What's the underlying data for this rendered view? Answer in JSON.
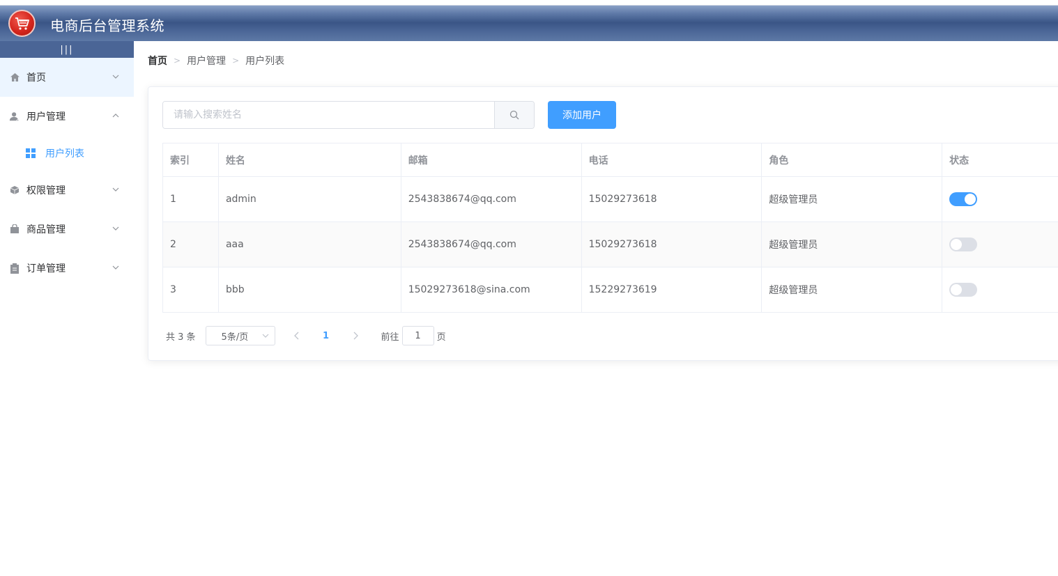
{
  "header": {
    "title": "电商后台管理系统",
    "logo_icon": "shopping-cart-icon"
  },
  "sidebar": {
    "toggle_label": "|||",
    "items": [
      {
        "label": "首页",
        "icon": "home-icon"
      },
      {
        "label": "用户管理",
        "icon": "user-icon",
        "expanded": true
      },
      {
        "label": "权限管理",
        "icon": "box-icon"
      },
      {
        "label": "商品管理",
        "icon": "bag-icon"
      },
      {
        "label": "订单管理",
        "icon": "clipboard-icon"
      }
    ],
    "sub_items": [
      {
        "label": "用户列表",
        "icon": "grid-icon",
        "active": true
      }
    ]
  },
  "breadcrumb": [
    "首页",
    "用户管理",
    "用户列表"
  ],
  "search": {
    "placeholder": "请输入搜索姓名",
    "value": ""
  },
  "add_button_label": "添加用户",
  "table": {
    "headers": [
      "索引",
      "姓名",
      "邮箱",
      "电话",
      "角色",
      "状态"
    ],
    "rows": [
      {
        "index": "1",
        "name": "admin",
        "email": "2543838674@qq.com",
        "phone": "15029273618",
        "role": "超级管理员",
        "status": true
      },
      {
        "index": "2",
        "name": "aaa",
        "email": "2543838674@qq.com",
        "phone": "15029273618",
        "role": "超级管理员",
        "status": false
      },
      {
        "index": "3",
        "name": "bbb",
        "email": "15029273618@sina.com",
        "phone": "15229273619",
        "role": "超级管理员",
        "status": false
      }
    ]
  },
  "pagination": {
    "total_text": "共 3 条",
    "page_size": "5条/页",
    "current_page": "1",
    "goto_prefix": "前往",
    "goto_value": "1",
    "goto_suffix": "页"
  },
  "colors": {
    "primary": "#409eff",
    "header_dark": "#3a5586",
    "sidebar_active_bg": "#ecf5ff"
  }
}
